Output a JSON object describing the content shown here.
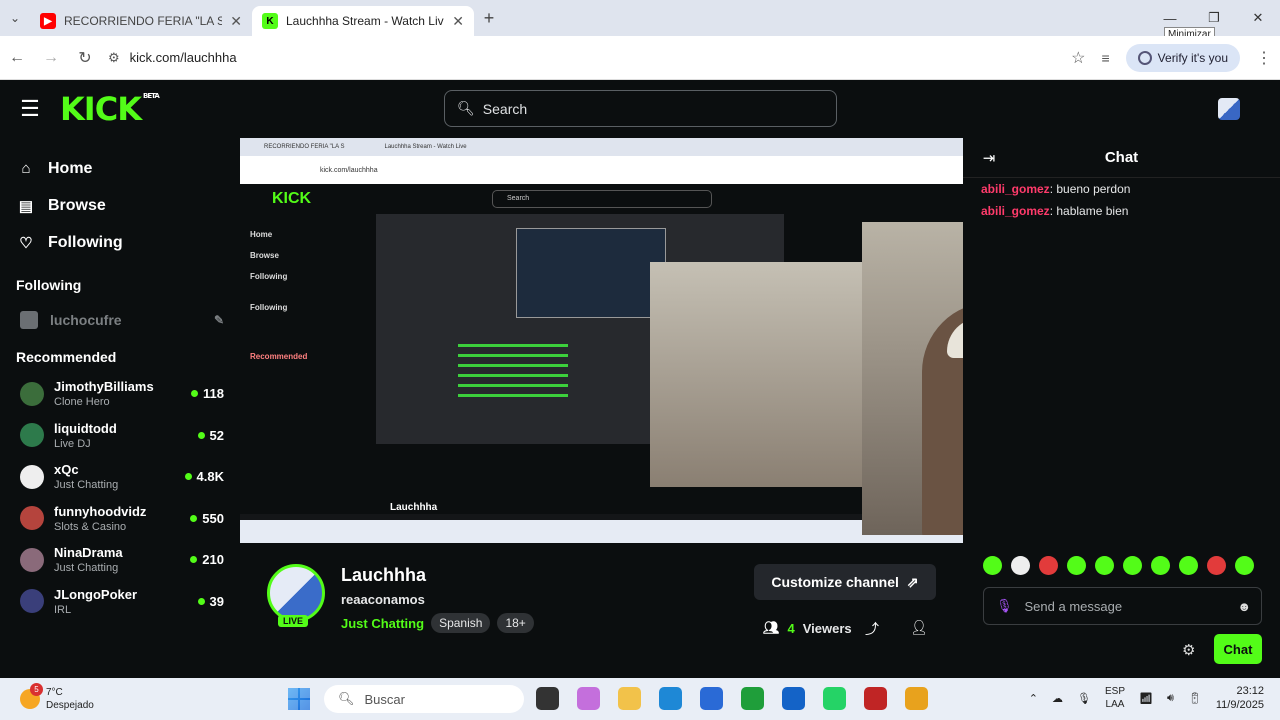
{
  "browser": {
    "tabs": [
      {
        "title": "RECORRIENDO FERIA \"LA SALA",
        "favicon": "youtube-icon",
        "active": false
      },
      {
        "title": "Lauchhha Stream - Watch Live",
        "favicon": "kick-icon",
        "active": true
      }
    ],
    "url": "kick.com/lauchhha",
    "verify_label": "Verify it's you",
    "tooltip": "Minimizar"
  },
  "header": {
    "logo": "KICK",
    "logo_tag": "BETA",
    "search_placeholder": "Search"
  },
  "sidebar": {
    "nav": [
      {
        "label": "Home",
        "icon": "home-icon"
      },
      {
        "label": "Browse",
        "icon": "browse-icon"
      },
      {
        "label": "Following",
        "icon": "heart-icon"
      }
    ],
    "following_title": "Following",
    "following": [
      {
        "name": "luchocufre"
      }
    ],
    "recommended_title": "Recommended",
    "recommended": [
      {
        "name": "JimothyBilliams",
        "category": "Clone Hero",
        "viewers": "118",
        "color": "#3b6d3b"
      },
      {
        "name": "liquidtodd",
        "category": "Live DJ",
        "viewers": "52",
        "color": "#2d7a4b"
      },
      {
        "name": "xQc",
        "category": "Just Chatting",
        "viewers": "4.8K",
        "color": "#eeeeee"
      },
      {
        "name": "funnyhoodvidz",
        "category": "Slots & Casino",
        "viewers": "550",
        "color": "#b5443d"
      },
      {
        "name": "NinaDrama",
        "category": "Just Chatting",
        "viewers": "210",
        "color": "#8a6a7a"
      },
      {
        "name": "JLongoPoker",
        "category": "IRL",
        "viewers": "39",
        "color": "#3a3f7a"
      }
    ]
  },
  "stream": {
    "inner_tabs": [
      "RECORRIENDO FERIA \"LA S",
      "Lauchhha Stream - Watch Live"
    ],
    "inner_url": "kick.com/lauchhha",
    "inner_search": "Search",
    "inner_nav": [
      "Home",
      "Browse",
      "Following",
      "Following",
      "Recommended"
    ],
    "inner_channel": "Lauchhha"
  },
  "channel": {
    "name": "Lauchhha",
    "live": "LIVE",
    "title": "reaaconamos",
    "category": "Just Chatting",
    "tags": [
      "Spanish",
      "18+"
    ],
    "customize_label": "Customize channel",
    "viewers_count": "4",
    "viewers_label": "Viewers"
  },
  "chat": {
    "title": "Chat",
    "messages": [
      {
        "user": "abili_gomez",
        "text": "bueno perdon"
      },
      {
        "user": "abili_gomez",
        "text": "hablame bien"
      }
    ],
    "send_placeholder": "Send a message",
    "send_button": "Chat"
  },
  "taskbar": {
    "weather_temp": "7°C",
    "weather_desc": "Despejado",
    "weather_badge": "5",
    "search_placeholder": "Buscar",
    "lang1": "ESP",
    "lang2": "LAA",
    "time": "23:12",
    "date": "11/9/2025"
  }
}
